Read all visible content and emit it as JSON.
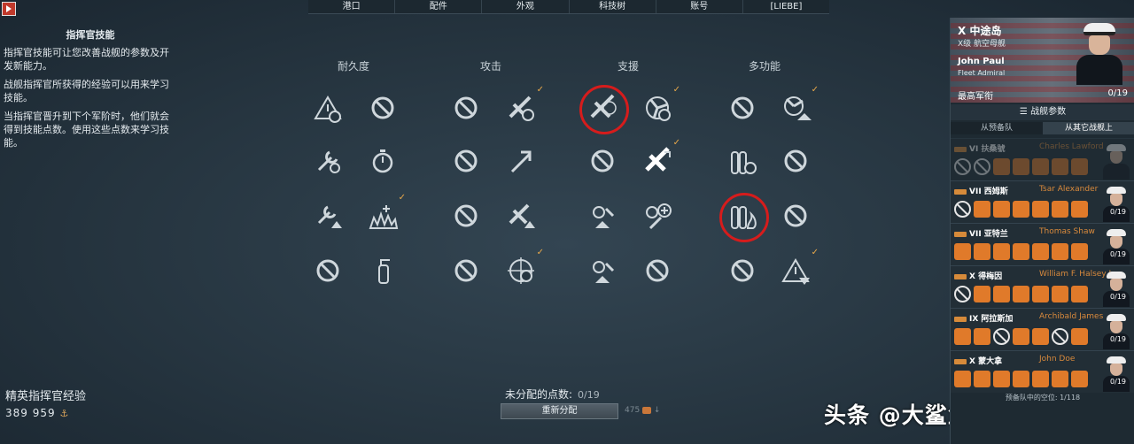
{
  "nav": {
    "tabs": [
      "港口",
      "配件",
      "外观",
      "科技树",
      "账号",
      "[LIEBE]"
    ]
  },
  "description": {
    "title": "指挥官技能",
    "p1": "指挥官技能可让您改善战舰的参数及开发新能力。",
    "p2": "战舰指挥官所获得的经验可以用来学习技能。",
    "p3": "当指挥官晋升到下个军阶时，他们就会得到技能点数。使用这些点数来学习技能。"
  },
  "elite": {
    "label": "精英指挥官经验",
    "value": "389 959"
  },
  "columns": [
    "耐久度",
    "攻击",
    "支援",
    "多功能"
  ],
  "unallocated": {
    "label": "未分配的点数:",
    "points": "0/19"
  },
  "redistribute_label": "重新分配",
  "redistribute_cost": "475",
  "watermark": "头条 @大鲨鱼游戏视频",
  "commander": {
    "tier": "X",
    "ship": "中途岛",
    "class": "X级 航空母舰",
    "name": "John Paul",
    "rank": "Fleet Admiral",
    "rank_cn": "最高军衔",
    "points": "0/19"
  },
  "params_label": "战舰参数",
  "subtabs": [
    "从预备队",
    "从其它战舰上"
  ],
  "roster": [
    {
      "tier": "VI",
      "ship": "扶桑號",
      "name": "Charles Lawford",
      "skills": [
        "no",
        "no",
        "sk",
        "sk",
        "sk",
        "sk",
        "sk"
      ],
      "pts": ""
    },
    {
      "tier": "VII",
      "ship": "西姆斯",
      "name": "Tsar Alexander",
      "skills": [
        "no",
        "sk",
        "sk",
        "sk",
        "sk",
        "sk",
        "sk"
      ],
      "pts": "0/19"
    },
    {
      "tier": "VII",
      "ship": "亚特兰",
      "name": "Thomas Shaw",
      "skills": [
        "sk",
        "sk",
        "sk",
        "sk",
        "sk",
        "sk",
        "sk"
      ],
      "pts": "0/19"
    },
    {
      "tier": "X",
      "ship": "得梅因",
      "name": "William F. Halsey Jr.",
      "skills": [
        "no",
        "sk",
        "sk",
        "sk",
        "sk",
        "sk",
        "sk"
      ],
      "pts": "0/19"
    },
    {
      "tier": "IX",
      "ship": "阿拉斯加",
      "name": "Archibald James",
      "skills": [
        "sk",
        "sk",
        "no",
        "sk",
        "sk",
        "no",
        "sk"
      ],
      "pts": "0/19"
    },
    {
      "tier": "X",
      "ship": "蒙大拿",
      "name": "John Doe",
      "skills": [
        "sk",
        "sk",
        "sk",
        "sk",
        "sk",
        "sk",
        "sk"
      ],
      "pts": "0/19"
    }
  ],
  "roster_footer": "预备队中的空位: 1/118"
}
